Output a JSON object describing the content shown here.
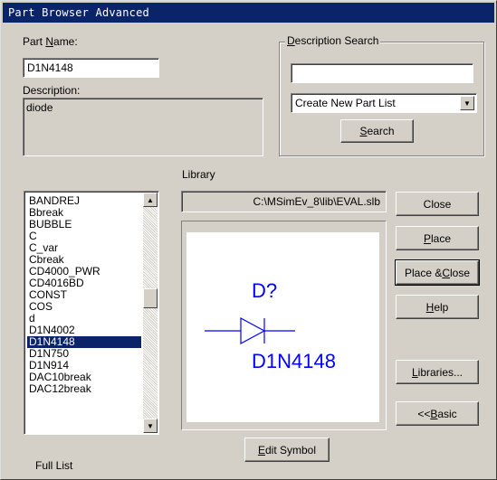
{
  "window": {
    "title": "Part Browser Advanced"
  },
  "part_name": {
    "label": "Part Name:",
    "label_pre": "Part ",
    "label_u": "N",
    "label_post": "ame:",
    "value": "D1N4148"
  },
  "description": {
    "label": "Description:",
    "value": "diode"
  },
  "description_search": {
    "title": "Description Search",
    "title_u": "D",
    "title_post": "escription Search",
    "query": "",
    "list_mode": "Create New Part List",
    "search_label": "Search",
    "search_u": "S",
    "search_post": "earch"
  },
  "library": {
    "label": "Library",
    "path": "C:\\MSimEv_8\\lib\\EVAL.slb"
  },
  "parts_list": {
    "items": [
      "BANDREJ",
      "Bbreak",
      "BUBBLE",
      "C",
      "C_var",
      "Cbreak",
      "CD4000_PWR",
      "CD4016BD",
      "CONST",
      "COS",
      "d",
      "D1N4002",
      "D1N4148",
      "D1N750",
      "D1N914",
      "DAC10break",
      "DAC12break"
    ],
    "selected": "D1N4148"
  },
  "preview": {
    "ref": "D?",
    "value": "D1N4148"
  },
  "buttons": {
    "close": "Close",
    "place_u": "P",
    "place_post": "lace",
    "place_close_pre": "Place & ",
    "place_close_u": "C",
    "place_close_post": "lose",
    "help_u": "H",
    "help_post": "elp",
    "libraries_u": "L",
    "libraries_post": "ibraries...",
    "basic_pre": "<< ",
    "basic_u": "B",
    "basic_post": "asic",
    "edit_symbol_u": "E",
    "edit_symbol_post": "dit Symbol"
  },
  "full_list_label": "Full List",
  "colors": {
    "titlebar": "#0a246a",
    "face": "#d4d0c8",
    "symbol": "#0000ff"
  }
}
